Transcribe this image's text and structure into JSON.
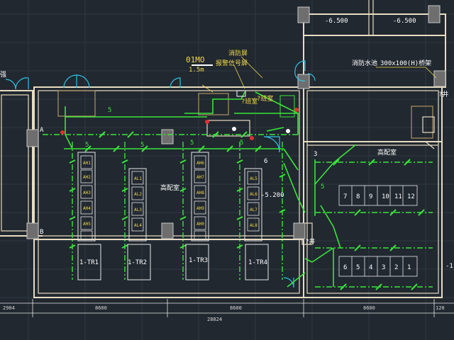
{
  "labels": {
    "axis_a": "A",
    "axis_b": "B",
    "elev_1": "-6.500",
    "elev_2": "-6.500",
    "elev_3": "-5.200",
    "fire_pool": "消防水池",
    "duct": "300x100(H)桥架",
    "code_01mo": "01MO",
    "h15": "1.5m",
    "fire_cabinet": "消防屏",
    "alarm_cabinet": "报警信号屏",
    "duty_room_1": "?班室",
    "duty_room_2": "?班室",
    "substation_1": "高配室",
    "substation_2": "高配室",
    "tr1": "1-TR1",
    "tr2": "1-TR2",
    "tr3": "1-TR3",
    "tr4": "1-TR4",
    "shaft_1": "?井",
    "shaft_2": "?井",
    "left_edge": "强",
    "right_edge": "-1",
    "n5a": "5",
    "n5b": "5",
    "n5c": "5",
    "n5d": "5",
    "n5e": "5",
    "n5f": "5",
    "n3": "3",
    "n6": "6",
    "dim_1": "2904",
    "dim_2": "8600",
    "dim_3": "8600",
    "dim_4": "8600",
    "dim_5": "120",
    "dim_total": "28824"
  },
  "cabinet_row_upper": [
    "7",
    "8",
    "9",
    "10",
    "11",
    "12"
  ],
  "cabinet_row_lower": [
    "6",
    "5",
    "4",
    "3",
    "2",
    "1"
  ],
  "colors": {
    "background": "#212830",
    "wall": "#e8dcc0",
    "lighting": "#39e639",
    "door": "#2ec4e8",
    "text": "#f2d94a"
  }
}
